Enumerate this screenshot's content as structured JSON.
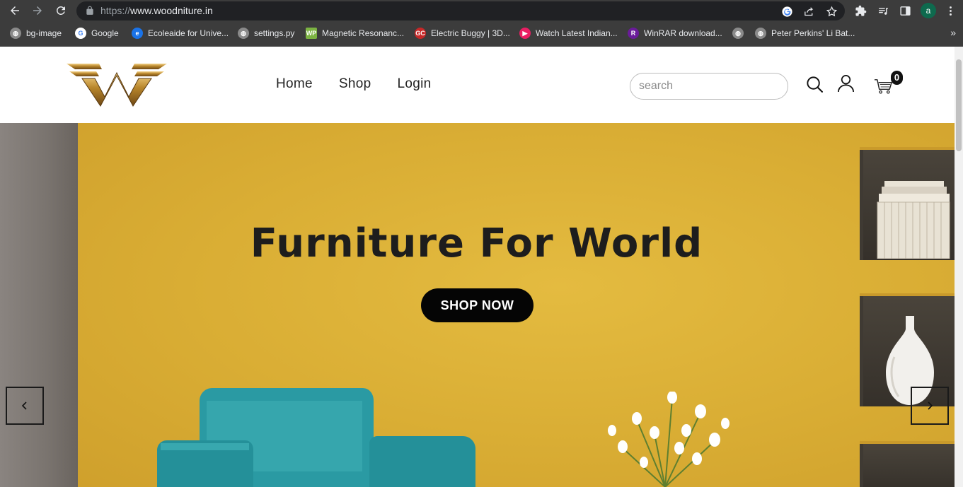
{
  "browser": {
    "url_scheme": "https://",
    "url_host": "www.woodniture.in",
    "profile_initial": "a",
    "bookmarks": [
      {
        "label": "bg-image",
        "icon": "globe-icon",
        "color": "#8a8a8a"
      },
      {
        "label": "Google",
        "icon": "google-icon",
        "color": "#4285f4"
      },
      {
        "label": "Ecoleaide for Unive...",
        "icon": "ecoleaide-icon",
        "color": "#1a73e8"
      },
      {
        "label": "settings.py",
        "icon": "globe-icon",
        "color": "#8a8a8a"
      },
      {
        "label": "Magnetic Resonanc...",
        "icon": "wp-icon",
        "color": "#7cb342"
      },
      {
        "label": "Electric Buggy | 3D...",
        "icon": "gc-icon",
        "color": "#c62828"
      },
      {
        "label": "Watch Latest Indian...",
        "icon": "tv-icon",
        "color": "#e91e63"
      },
      {
        "label": "WinRAR download...",
        "icon": "winrar-icon",
        "color": "#6a1b9a"
      },
      {
        "label": "",
        "icon": "globe-icon",
        "color": "#8a8a8a"
      },
      {
        "label": "Peter Perkins' Li Bat...",
        "icon": "globe-icon",
        "color": "#8a8a8a"
      }
    ],
    "more_bookmarks": "»"
  },
  "site": {
    "nav": {
      "home": "Home",
      "shop": "Shop",
      "login": "Login"
    },
    "search_placeholder": "search",
    "cart_count": "0",
    "brand_colors": {
      "logo_gold": "#b8862b",
      "hero_yellow": "#d8ae33",
      "button": "#050505"
    }
  },
  "hero": {
    "title": "Furniture For World",
    "cta": "SHOP NOW",
    "prev_icon": "chevron-left-icon",
    "next_icon": "chevron-right-icon"
  }
}
